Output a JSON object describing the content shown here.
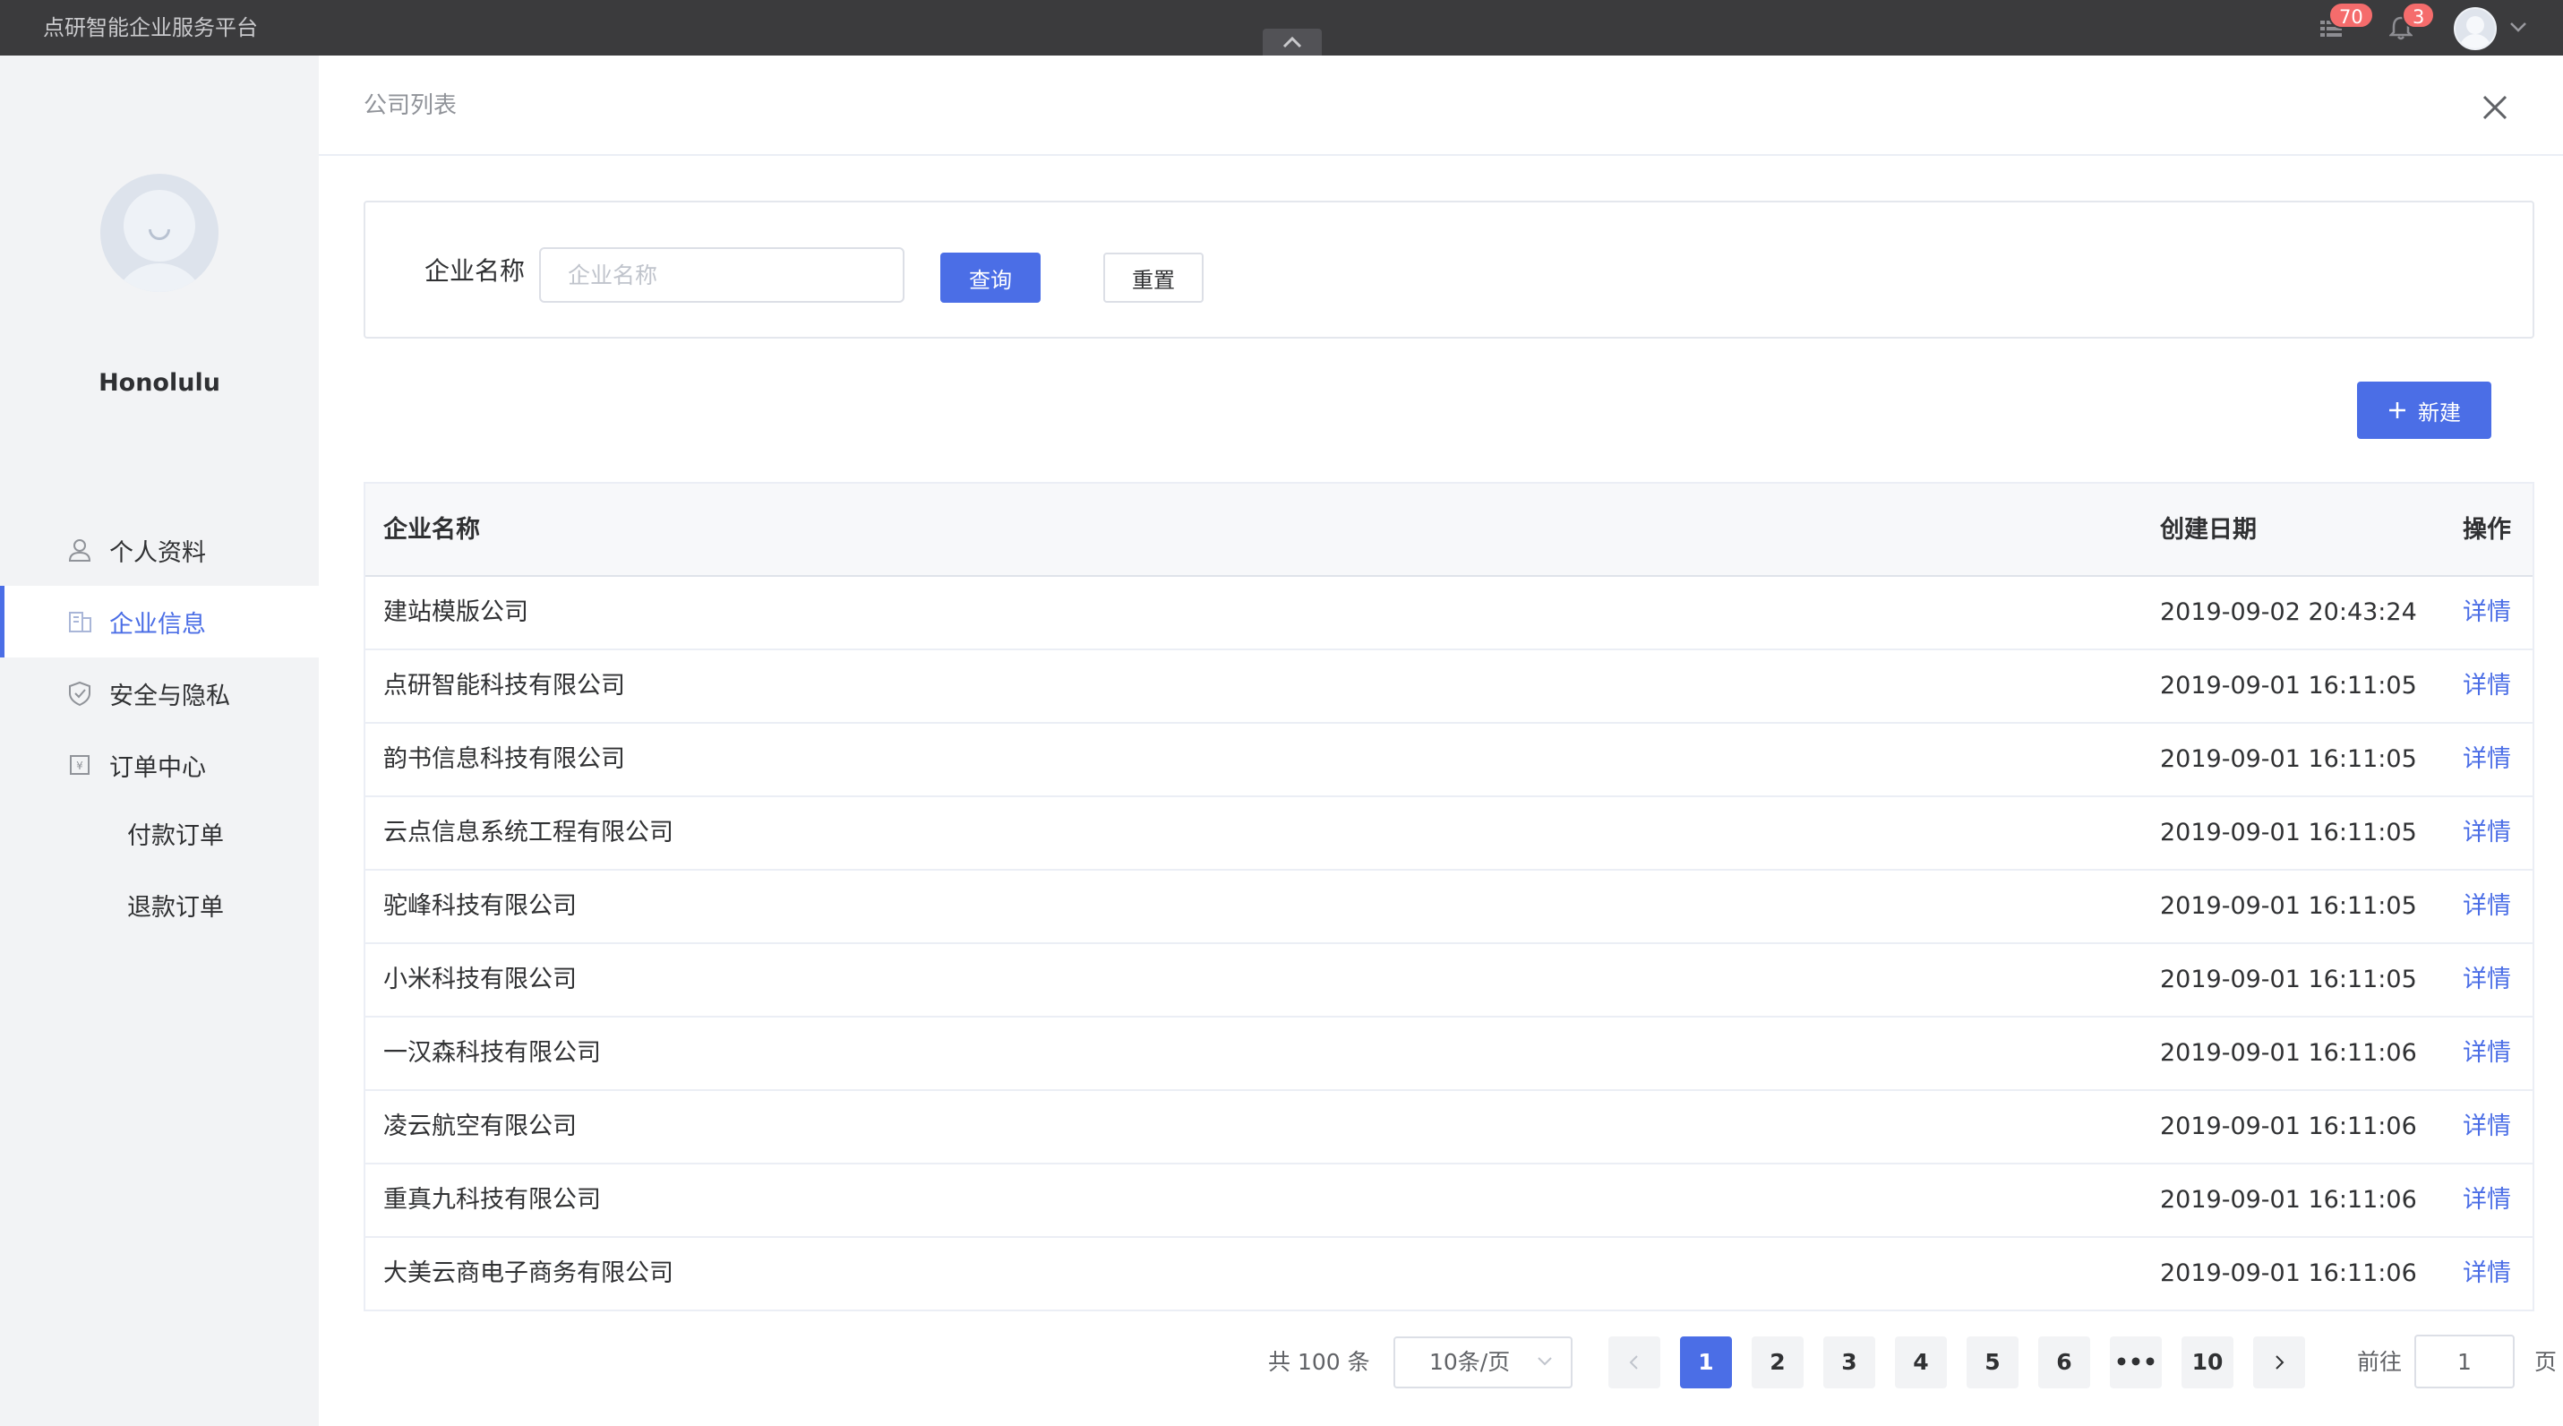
{
  "app": {
    "brand": "点研智能企业服务平台"
  },
  "topbar": {
    "apps_badge": "70",
    "bell_badge": "3"
  },
  "sidebar": {
    "username": "Honolulu",
    "items": [
      {
        "label": "个人资料",
        "icon": "user-icon"
      },
      {
        "label": "企业信息",
        "icon": "building-icon",
        "active": true
      },
      {
        "label": "安全与隐私",
        "icon": "shield-icon"
      },
      {
        "label": "订单中心",
        "icon": "order-icon"
      }
    ],
    "subitems": [
      {
        "label": "付款订单"
      },
      {
        "label": "退款订单"
      }
    ]
  },
  "page": {
    "title": "公司列表"
  },
  "search": {
    "label": "企业名称",
    "placeholder": "企业名称",
    "value": "",
    "query_label": "查询",
    "reset_label": "重置"
  },
  "toolbar": {
    "new_label": "新建"
  },
  "table": {
    "columns": [
      "企业名称",
      "创建日期",
      "操作"
    ],
    "rows": [
      {
        "name": "建站模版公司",
        "date": "2019-09-02 20:43:24",
        "action": "详情"
      },
      {
        "name": "点研智能科技有限公司",
        "date": "2019-09-01 16:11:05",
        "action": "详情"
      },
      {
        "name": "韵书信息科技有限公司",
        "date": "2019-09-01 16:11:05",
        "action": "详情"
      },
      {
        "name": "云点信息系统工程有限公司",
        "date": "2019-09-01 16:11:05",
        "action": "详情"
      },
      {
        "name": "驼峰科技有限公司",
        "date": "2019-09-01 16:11:05",
        "action": "详情"
      },
      {
        "name": "小米科技有限公司",
        "date": "2019-09-01 16:11:05",
        "action": "详情"
      },
      {
        "name": "一汉森科技有限公司",
        "date": "2019-09-01 16:11:06",
        "action": "详情"
      },
      {
        "name": "凌云航空有限公司",
        "date": "2019-09-01 16:11:06",
        "action": "详情"
      },
      {
        "name": "重真九科技有限公司",
        "date": "2019-09-01 16:11:06",
        "action": "详情"
      },
      {
        "name": "大美云商电子商务有限公司",
        "date": "2019-09-01 16:11:06",
        "action": "详情"
      }
    ]
  },
  "pagination": {
    "total_text": "共 100 条",
    "page_size": "10条/页",
    "pages": [
      "1",
      "2",
      "3",
      "4",
      "5",
      "6",
      "•••",
      "10"
    ],
    "current": "1",
    "goto_label": "前往",
    "goto_value": "1",
    "goto_suffix": "页"
  },
  "colors": {
    "primary": "#4b6ee6",
    "topbar": "#3b3b3d",
    "sidebar": "#f2f3f5",
    "badge": "#f56c6c"
  }
}
